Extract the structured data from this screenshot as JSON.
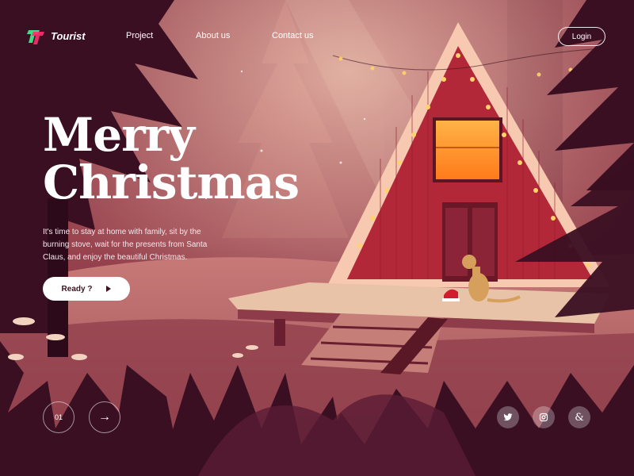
{
  "brand": {
    "name": "Tourist"
  },
  "nav": {
    "items": [
      {
        "label": "Project"
      },
      {
        "label": "About us"
      },
      {
        "label": "Contact us"
      }
    ],
    "login_label": "Login"
  },
  "hero": {
    "title_line1": "Merry",
    "title_line2": "Christmas",
    "description": "It's time to stay at home with family, sit by the burning stove, wait for the presents from Santa Claus, and enjoy the beautiful Christmas.",
    "cta_label": "Ready ?"
  },
  "pager": {
    "current": "01"
  },
  "social": [
    "twitter-icon",
    "instagram-icon",
    "ampersand-icon"
  ],
  "colors": {
    "background": "#7a2a3a",
    "cabin": "#b8283b",
    "window": "#ff9a2a",
    "foliage_dark": "#3a0f22",
    "text": "#ffffff"
  }
}
